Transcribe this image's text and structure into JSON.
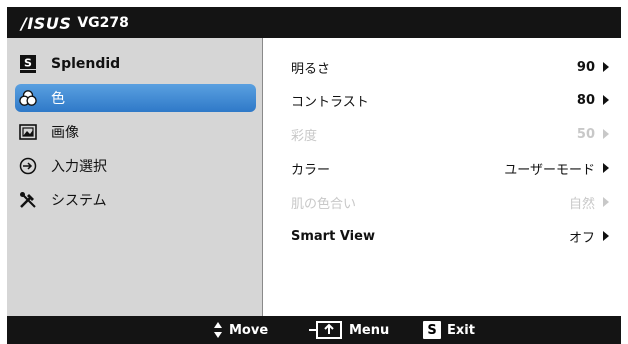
{
  "titlebar": {
    "brand": "/ISUS",
    "model": "VG278"
  },
  "sidebar": {
    "items": [
      {
        "label": "Splendid",
        "icon": "splendid-s-icon"
      },
      {
        "label": "色",
        "icon": "color-circles-icon"
      },
      {
        "label": "画像",
        "icon": "image-icon"
      },
      {
        "label": "入力選択",
        "icon": "input-select-icon"
      },
      {
        "label": "システム",
        "icon": "system-tools-icon"
      }
    ],
    "active_index": 1
  },
  "settings": [
    {
      "label": "明るさ",
      "value": "90",
      "enabled": true
    },
    {
      "label": "コントラスト",
      "value": "80",
      "enabled": true
    },
    {
      "label": "彩度",
      "value": "50",
      "enabled": false
    },
    {
      "label": "カラー",
      "value": "ユーザーモード",
      "enabled": true
    },
    {
      "label": "肌の色合い",
      "value": "自然",
      "enabled": false
    },
    {
      "label": "Smart View",
      "value": "オフ",
      "enabled": true
    }
  ],
  "footer": {
    "move_label": "Move",
    "menu_label": "Menu",
    "exit_label": "Exit",
    "exit_key": "S"
  },
  "colors": {
    "highlight": "#3a86d4",
    "bar": "#141414"
  }
}
